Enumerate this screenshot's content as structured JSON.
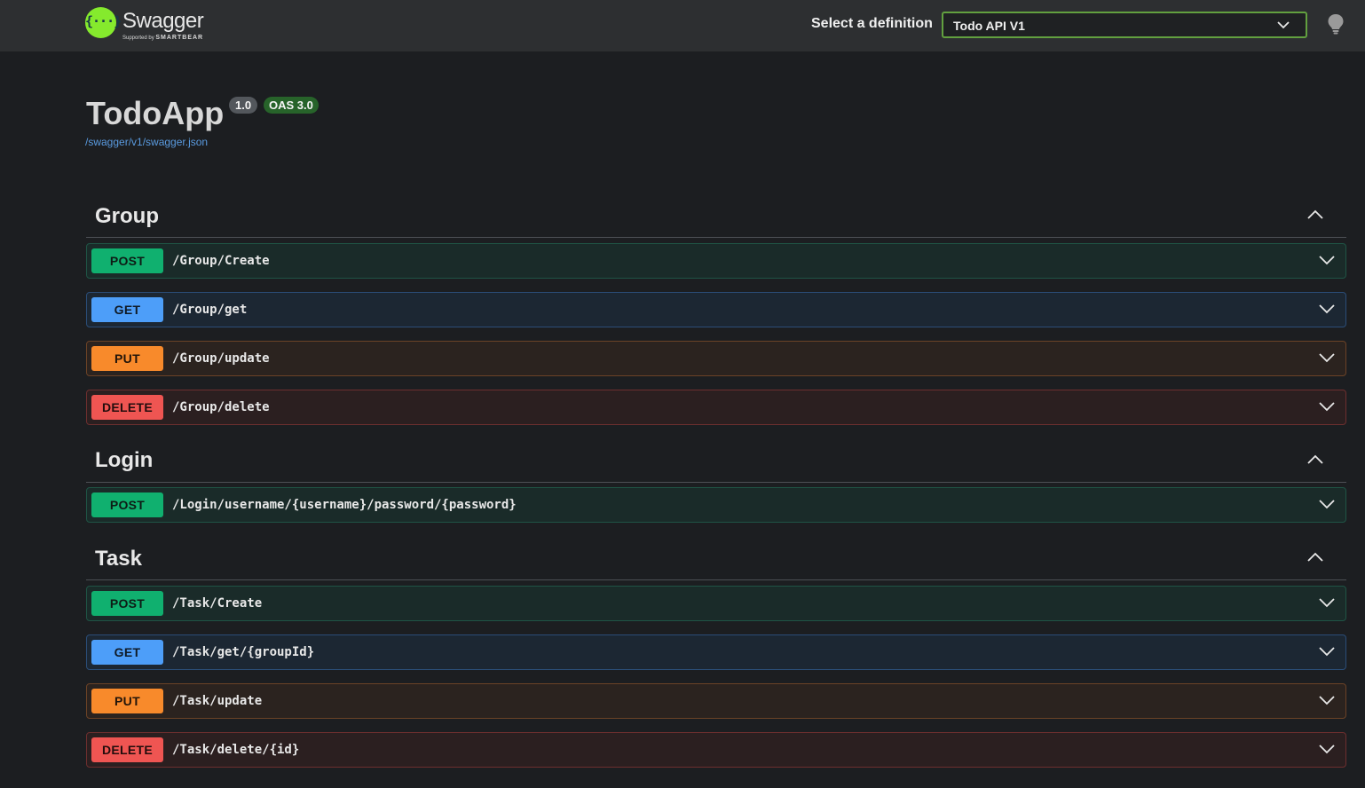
{
  "topbar": {
    "logo_text": "Swagger",
    "logo_glyph": "{···}",
    "logo_sub_small": "Supported by",
    "logo_sub_brand": "SMARTBEAR",
    "definition_label": "Select a definition",
    "definition_value": "Todo API V1",
    "theme_icon": "lightbulb-icon"
  },
  "info": {
    "title": "TodoApp",
    "version": "1.0",
    "oas": "OAS 3.0",
    "spec_url": "/swagger/v1/swagger.json"
  },
  "colors": {
    "post": "#10b06f",
    "get": "#4d9ef9",
    "put": "#f88a2b",
    "delete": "#ef5552",
    "accent": "#85ea2d"
  },
  "tags": [
    {
      "name": "Group",
      "operations": [
        {
          "method": "POST",
          "path": "/Group/Create"
        },
        {
          "method": "GET",
          "path": "/Group/get"
        },
        {
          "method": "PUT",
          "path": "/Group/update"
        },
        {
          "method": "DELETE",
          "path": "/Group/delete"
        }
      ]
    },
    {
      "name": "Login",
      "operations": [
        {
          "method": "POST",
          "path": "/Login/username/{username}/password/{password}"
        }
      ]
    },
    {
      "name": "Task",
      "operations": [
        {
          "method": "POST",
          "path": "/Task/Create"
        },
        {
          "method": "GET",
          "path": "/Task/get/{groupId}"
        },
        {
          "method": "PUT",
          "path": "/Task/update"
        },
        {
          "method": "DELETE",
          "path": "/Task/delete/{id}"
        }
      ]
    }
  ]
}
